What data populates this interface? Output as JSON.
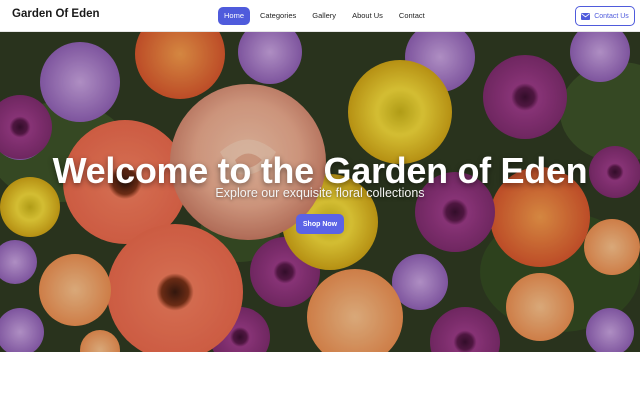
{
  "brand": {
    "name": "Garden Of Eden"
  },
  "nav": {
    "items": [
      {
        "label": "Home",
        "active": true
      },
      {
        "label": "Categories",
        "active": false
      },
      {
        "label": "Gallery",
        "active": false
      },
      {
        "label": "About Us",
        "active": false
      },
      {
        "label": "Contact",
        "active": false
      }
    ],
    "contact_button": {
      "label": "Contact Us",
      "icon": "mail-icon"
    }
  },
  "hero": {
    "title": "Welcome to the Garden of Eden",
    "subtitle": "Explore our exquisite floral collections",
    "cta_label": "Shop Now",
    "image": "flower-bouquet-background"
  },
  "colors": {
    "accent": "#4f5bdc",
    "button": "#5b63e6",
    "navbar_bg": "#ffffff"
  }
}
